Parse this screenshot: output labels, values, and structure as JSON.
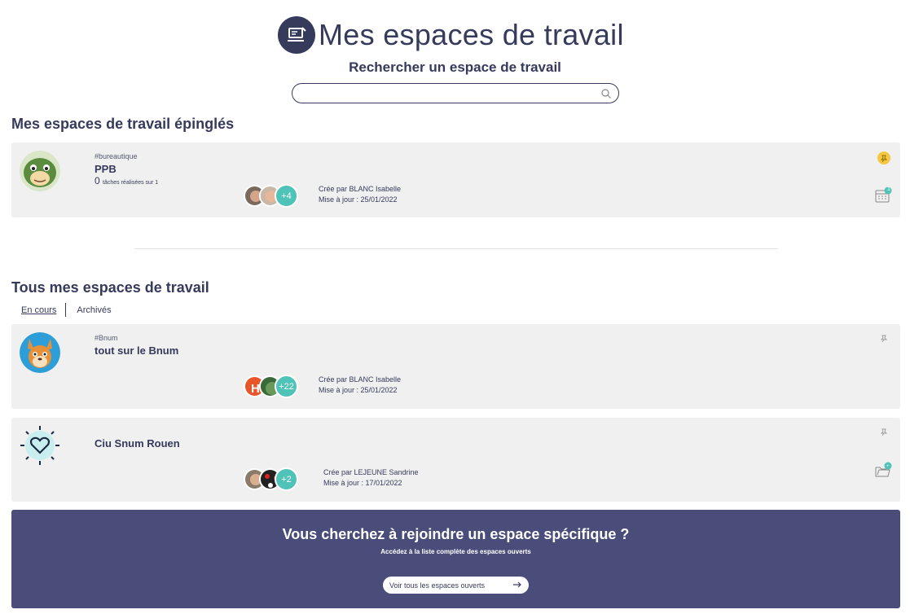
{
  "header": {
    "title": "Mes espaces de travail",
    "search_label": "Rechercher un espace de travail",
    "search_placeholder": ""
  },
  "pinned_section": {
    "title": "Mes espaces de travail épinglés",
    "cards": [
      {
        "tag": "#bureautique",
        "name": "PPB",
        "tasks_count": "0",
        "tasks_text": "tâches réalisées sur 1",
        "more_members": "+4",
        "created_by": "Crée par BLANC Isabelle",
        "updated": "Mise à jour : 25/01/2022",
        "calendar_badge": "1"
      }
    ]
  },
  "all_section": {
    "title": "Tous mes espaces de travail",
    "tabs": {
      "current": "En cours",
      "archived": "Archivés"
    },
    "cards": [
      {
        "tag": "#Bnum",
        "name": "tout sur le Bnum",
        "more_members": "+22",
        "created_by": "Crée par BLANC Isabelle",
        "updated": "Mise à jour : 25/01/2022"
      },
      {
        "tag": "",
        "name": "Ciu Snum Rouen",
        "more_members": "+2",
        "created_by": "Crée par LEJEUNE Sandrine",
        "updated": "Mise à jour : 17/01/2022"
      }
    ]
  },
  "banner": {
    "title": "Vous cherchez à rejoindre un espace spécifique ?",
    "subtitle": "Accédez à la liste complète des espaces ouverts",
    "button_label": "Voir tous les espaces ouverts"
  },
  "colors": {
    "primary": "#363a5b",
    "card_bg": "#f0f0f0",
    "accent_teal": "#4fc3b7",
    "pin_active": "#f5c842",
    "banner_bg": "#4a4d7a"
  }
}
